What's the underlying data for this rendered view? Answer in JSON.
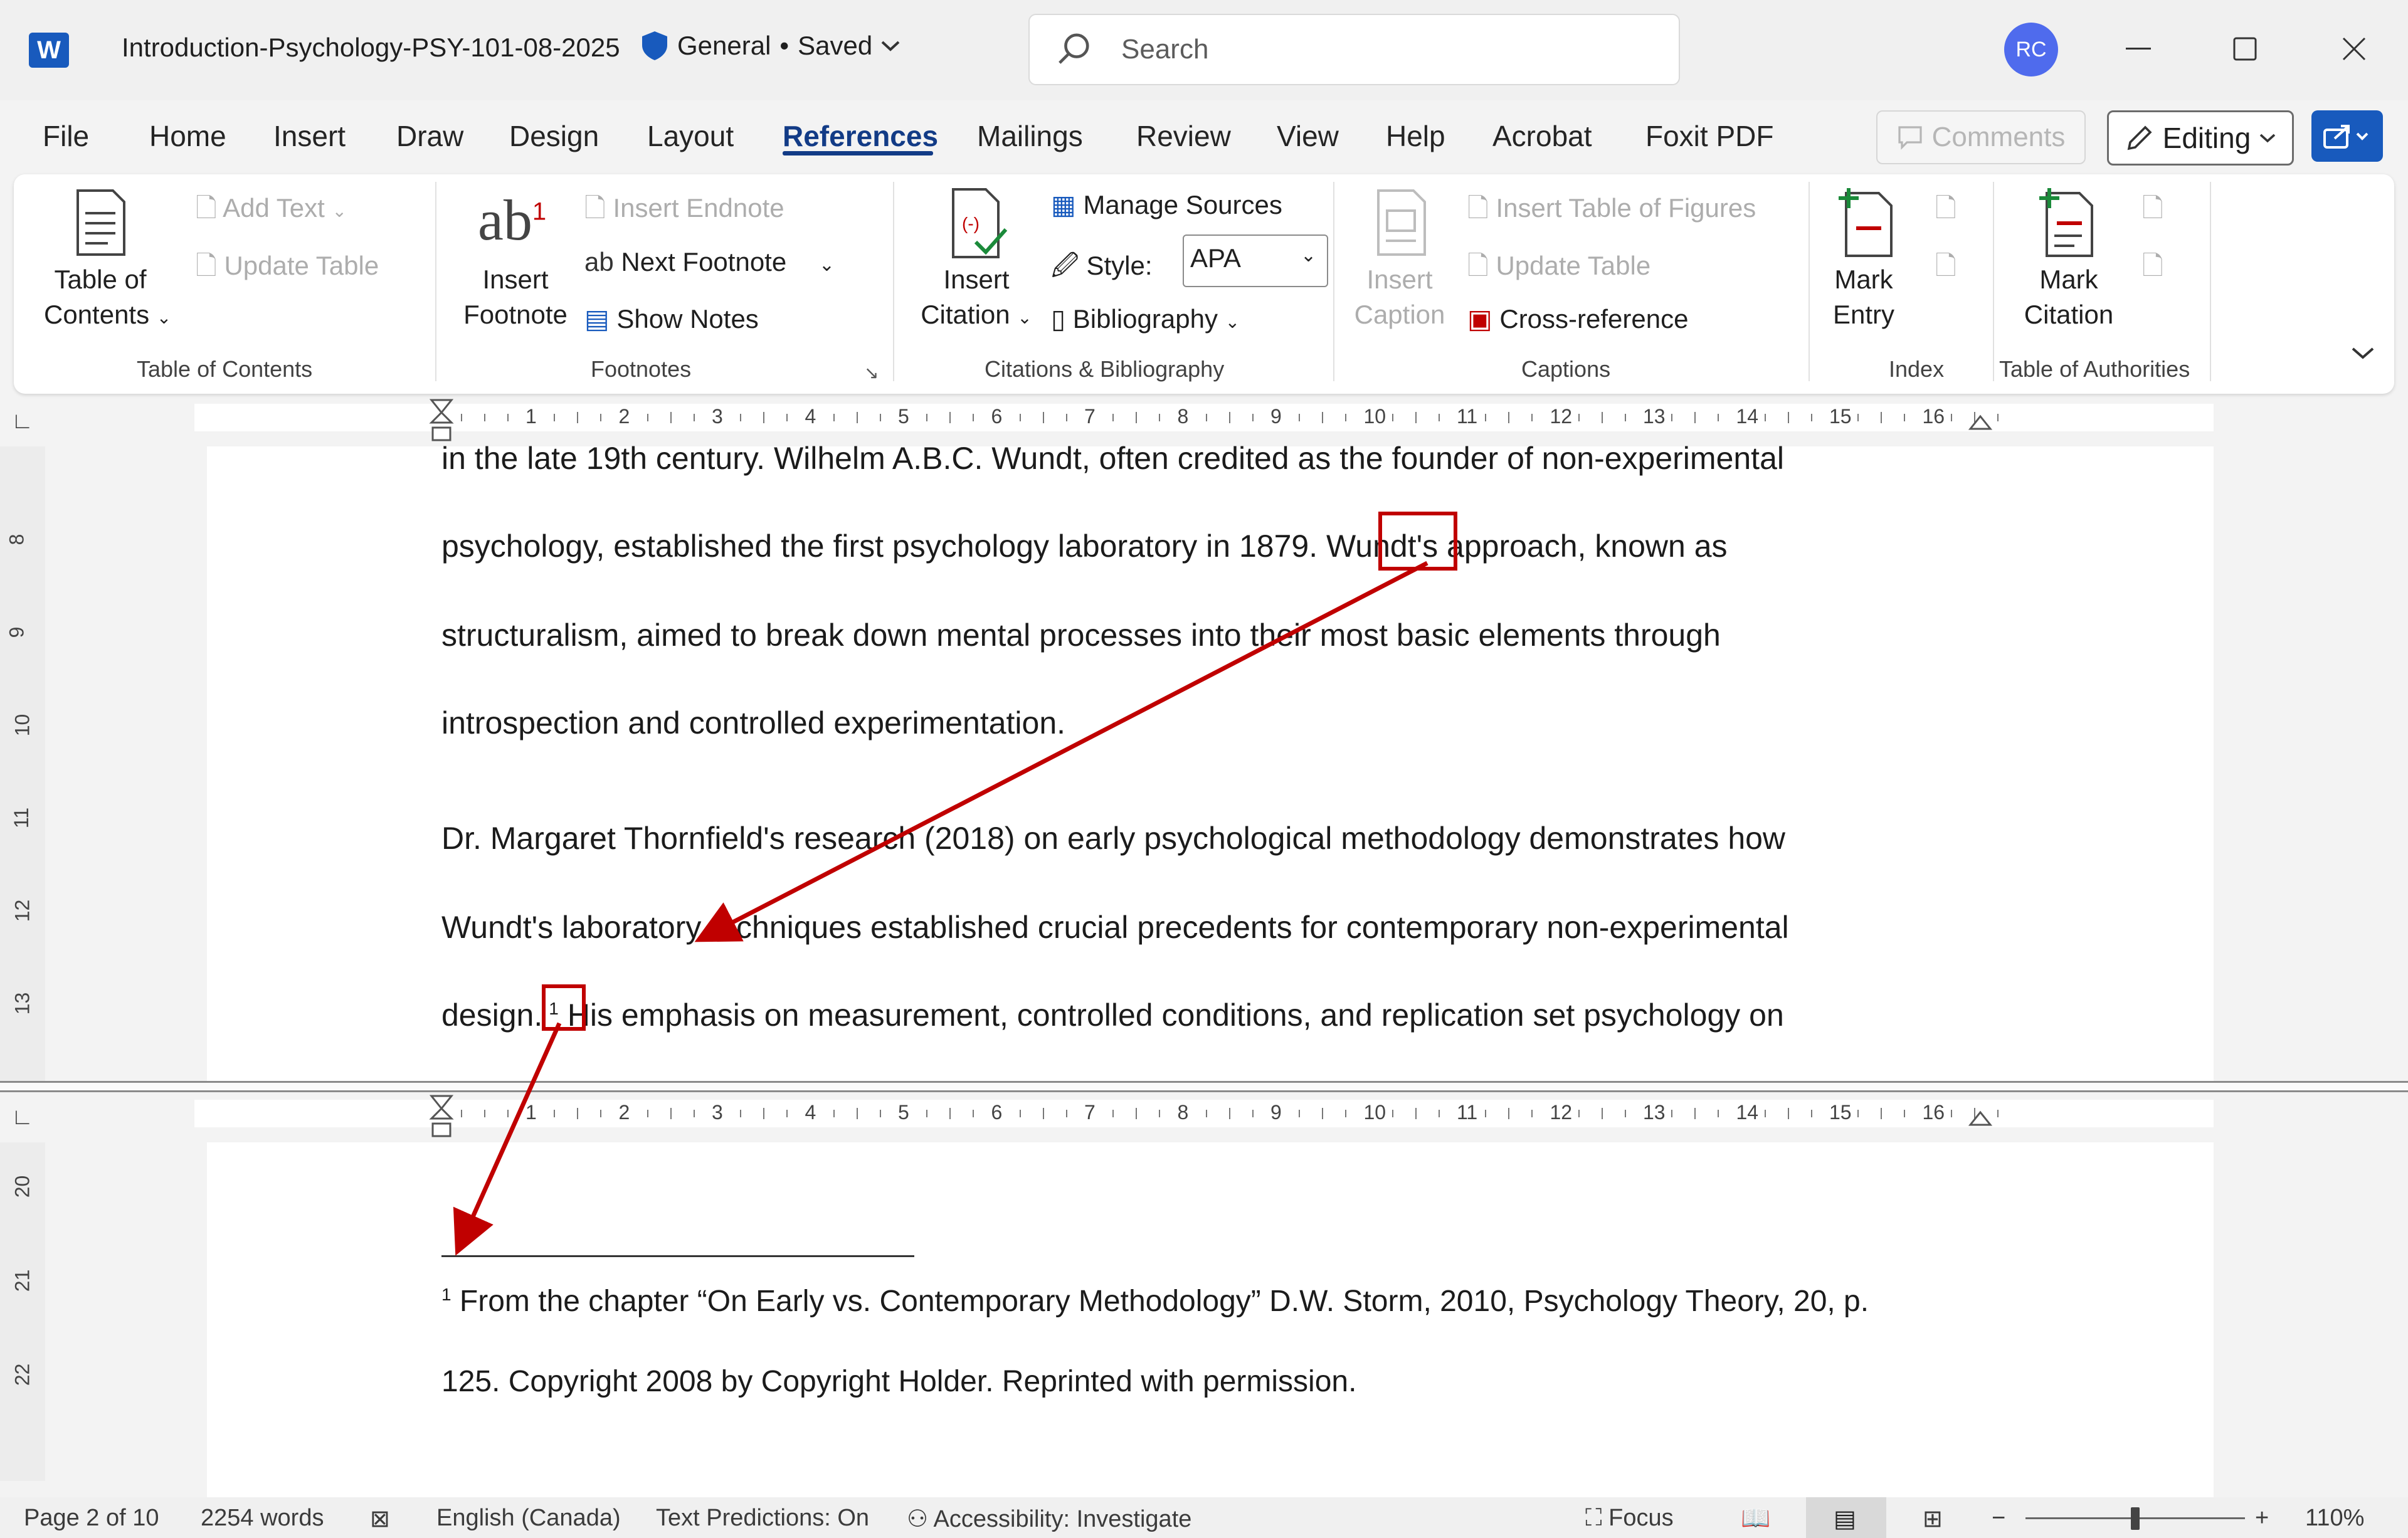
{
  "app": {
    "logo": "W",
    "doc_title": "Introduction-Psychology-PSY-101-08-2025",
    "sensitivity": "General",
    "save_state": "Saved",
    "search_placeholder": "Search",
    "user_initials": "RC"
  },
  "menu": {
    "tabs": [
      "File",
      "Home",
      "Insert",
      "Draw",
      "Design",
      "Layout",
      "References",
      "Mailings",
      "Review",
      "View",
      "Help",
      "Acrobat",
      "Foxit PDF"
    ],
    "active": "References",
    "comments_label": "Comments",
    "editing_label": "Editing"
  },
  "ribbon": {
    "toc": {
      "big_line1": "Table of",
      "big_line2": "Contents",
      "add_text": "Add Text",
      "update_table": "Update Table",
      "group": "Table of Contents"
    },
    "footnotes": {
      "icon_text": "ab",
      "sup": "1",
      "big_line1": "Insert",
      "big_line2": "Footnote",
      "insert_endnote": "Insert Endnote",
      "next_footnote": "Next Footnote",
      "show_notes": "Show Notes",
      "group": "Footnotes"
    },
    "citations": {
      "big_line1": "Insert",
      "big_line2": "Citation",
      "manage_sources": "Manage Sources",
      "style_label": "Style:",
      "style_value": "APA",
      "bibliography": "Bibliography",
      "group": "Citations & Bibliography"
    },
    "captions": {
      "big_line1": "Insert",
      "big_line2": "Caption",
      "insert_tof": "Insert Table of Figures",
      "update_table": "Update Table",
      "cross_reference": "Cross-reference",
      "group": "Captions"
    },
    "index": {
      "big_line1": "Mark",
      "big_line2": "Entry",
      "group": "Index"
    },
    "toa": {
      "big_line1": "Mark",
      "big_line2": "Citation",
      "group": "Table of Authorities"
    }
  },
  "ruler": {
    "numbers": [
      "1",
      "2",
      "3",
      "4",
      "5",
      "6",
      "7",
      "8",
      "9",
      "10",
      "11",
      "12",
      "13",
      "14",
      "15",
      "16"
    ],
    "vnumbers_top": [
      "8",
      "9",
      "10",
      "11",
      "12",
      "13"
    ],
    "vnumbers_bottom": [
      "20",
      "21",
      "22"
    ]
  },
  "document": {
    "lines": [
      "in the late 19th century. Wilhelm A.B.C. Wundt, often credited as the founder of non-experimental",
      "psychology, established the first psychology laboratory in 1879. Wundt's approach, known as",
      "structuralism, aimed to break down mental processes into their most basic elements through",
      "introspection and controlled experimentation.",
      "Dr. Margaret Thornfield's research (2018) on early psychological methodology demonstrates how",
      "Wundt's laboratory techniques established crucial precedents for contemporary non-experimental",
      "design.",
      "His emphasis on measurement, controlled conditions, and replication set psychology on"
    ],
    "footnote_ref": "1",
    "footnote": {
      "marker": "1",
      "line1": "From the chapter “On Early vs. Contemporary Methodology” D.W. Storm, 2010, Psychology Theory, 20, p.",
      "line2": "125. Copyright 2008 by Copyright Holder. Reprinted with permission."
    }
  },
  "status": {
    "page": "Page 2 of 10",
    "words": "2254 words",
    "language": "English (Canada)",
    "predictions": "Text Predictions: On",
    "accessibility": "Accessibility: Investigate",
    "focus": "Focus",
    "zoom": "110%"
  },
  "colors": {
    "accent": "#185abd",
    "annotation": "#c00000",
    "active_tab": "#123b86"
  }
}
